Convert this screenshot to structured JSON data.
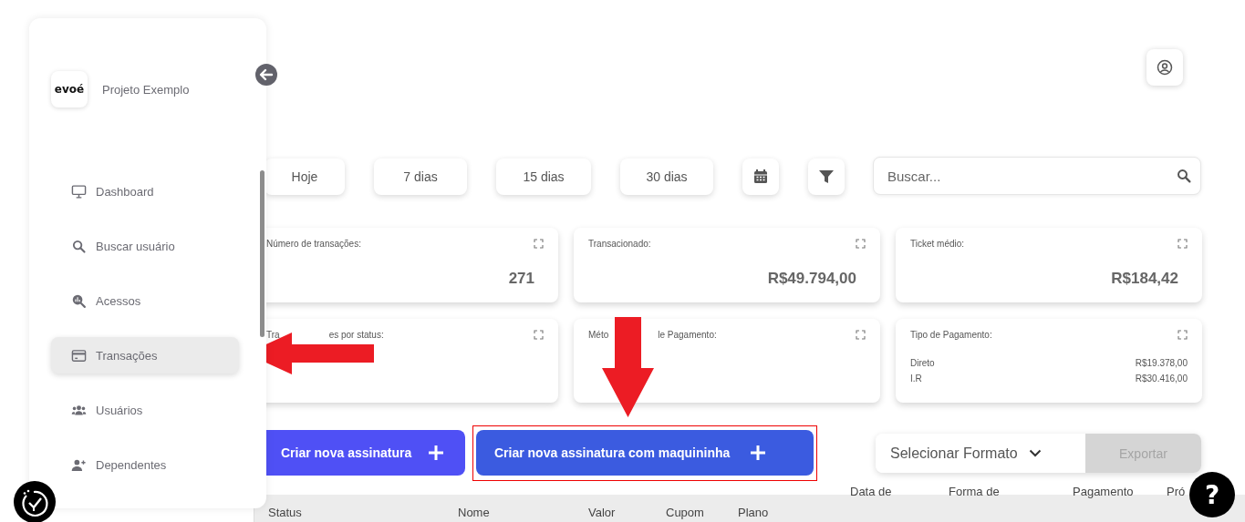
{
  "sidebar": {
    "project": "Projeto Exemplo",
    "logo": "evoé",
    "items": [
      {
        "label": "Dashboard",
        "selected": false
      },
      {
        "label": "Buscar usuário",
        "selected": false
      },
      {
        "label": "Acessos",
        "selected": false
      },
      {
        "label": "Transações",
        "selected": true
      },
      {
        "label": "Usuários",
        "selected": false
      },
      {
        "label": "Dependentes",
        "selected": false
      }
    ]
  },
  "filters": {
    "periods": [
      "Hoje",
      "7 dias",
      "15 dias",
      "30 dias"
    ],
    "search": {
      "placeholder": "Buscar..."
    }
  },
  "cards": [
    {
      "kind": "value",
      "title": [
        "Número de transações:"
      ],
      "value": "271"
    },
    {
      "kind": "value",
      "title": [
        "Transacionado:"
      ],
      "value": "R$49.794,00"
    },
    {
      "kind": "value",
      "title": [
        "Ticket médio:"
      ],
      "value": "R$184,42"
    },
    {
      "kind": "empty",
      "title": [
        "Tra",
        "es por status:"
      ]
    },
    {
      "kind": "empty",
      "title": [
        "Méto",
        "le Pagamento:"
      ]
    },
    {
      "kind": "list",
      "title": [
        "Tipo de Pagamento:"
      ],
      "rows": [
        {
          "label": "Direto",
          "value": "R$19.378,00"
        },
        {
          "label": "I.R",
          "value": "R$30.416,00"
        }
      ]
    }
  ],
  "actions": {
    "buttons": [
      "Criar nova assinatura",
      "Criar nova assinatura com maquininha"
    ],
    "format_select": "Selecionar Formato",
    "export": {
      "label": "Exportar",
      "disabled": true
    }
  },
  "table": {
    "columns": [
      "Status",
      "Nome",
      "Valor",
      "Cupom",
      "Plano",
      "Data de",
      "Forma de",
      "Pagamento",
      "Pró"
    ]
  },
  "help": "?"
}
